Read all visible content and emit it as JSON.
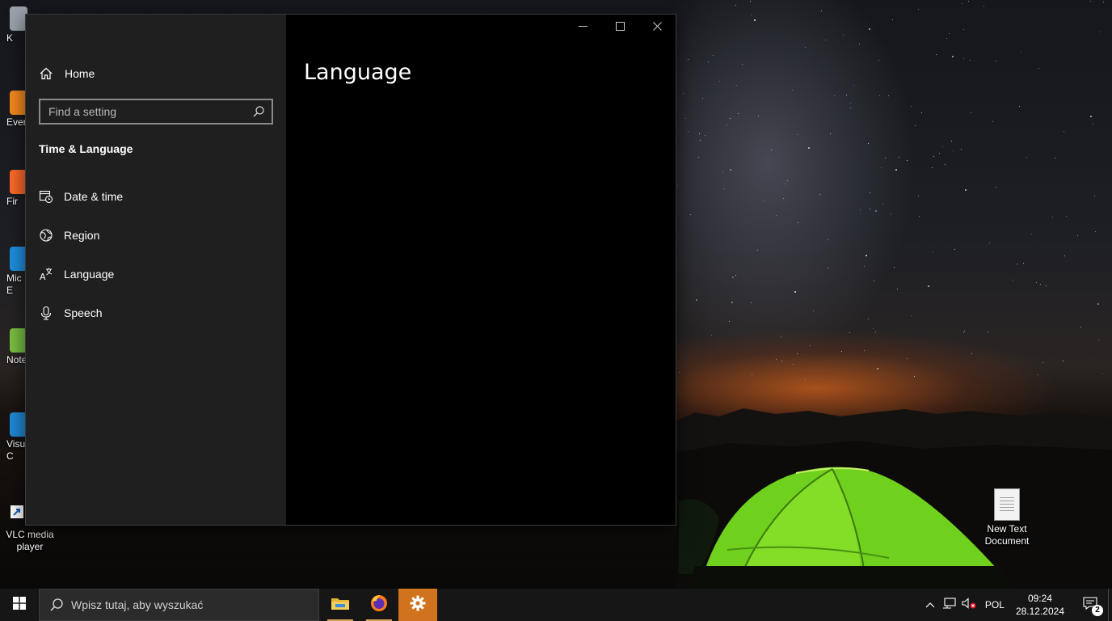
{
  "desktop": {
    "icons_left": [
      {
        "label": "K",
        "icon": "recycle-bin-icon"
      },
      {
        "label": "Ever",
        "icon": "app-shortcut-icon"
      },
      {
        "label": "Fir",
        "icon": "firefox-icon"
      },
      {
        "label": "Mic\nE",
        "icon": "edge-icon"
      },
      {
        "label": "Note",
        "icon": "notepad-plus-icon"
      },
      {
        "label": "Visua\nC",
        "icon": "vscode-icon"
      }
    ],
    "vlc_label": "VLC media player",
    "text_doc_label": "New Text Document"
  },
  "window": {
    "nav": {
      "home_label": "Home",
      "search_placeholder": "Find a setting",
      "section_title": "Time & Language",
      "items": [
        {
          "label": "Date & time",
          "icon": "calendar-clock-icon"
        },
        {
          "label": "Region",
          "icon": "globe-icon"
        },
        {
          "label": "Language",
          "icon": "language-icon"
        },
        {
          "label": "Speech",
          "icon": "microphone-icon"
        }
      ]
    },
    "page_title": "Language",
    "caption": {
      "minimize": "minimize-icon",
      "maximize": "maximize-icon",
      "close": "close-icon"
    }
  },
  "taskbar": {
    "search_placeholder": "Wpisz tutaj, aby wyszukać",
    "apps": [
      {
        "name": "file-explorer",
        "icon": "folder-icon"
      },
      {
        "name": "firefox",
        "icon": "firefox-icon"
      },
      {
        "name": "settings",
        "icon": "gear-icon",
        "active": true
      }
    ],
    "tray": {
      "language": "POL",
      "time": "09:24",
      "date": "28.12.2024",
      "notification_count": "2"
    }
  },
  "colors": {
    "taskbar_active": "#d0731c",
    "nav_bg": "#1f1f1f",
    "content_bg": "#000000"
  }
}
